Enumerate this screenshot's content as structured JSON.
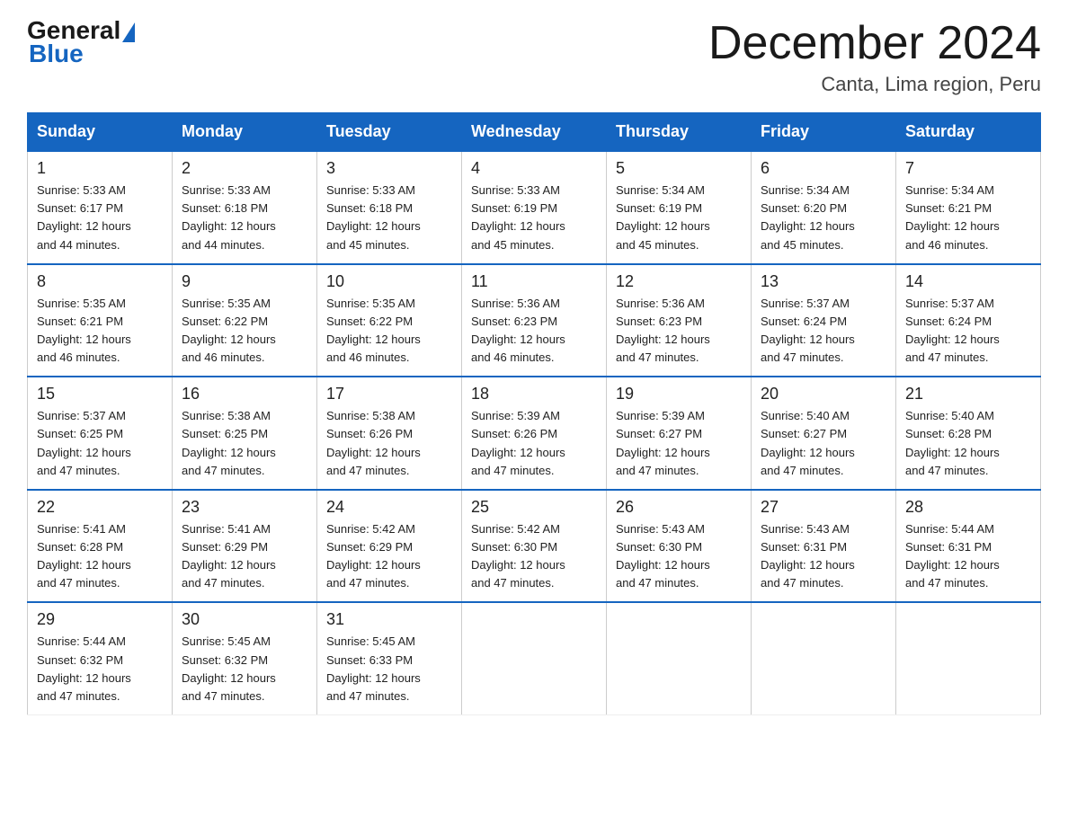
{
  "logo": {
    "general": "General",
    "blue": "Blue"
  },
  "title": "December 2024",
  "subtitle": "Canta, Lima region, Peru",
  "days_of_week": [
    "Sunday",
    "Monday",
    "Tuesday",
    "Wednesday",
    "Thursday",
    "Friday",
    "Saturday"
  ],
  "weeks": [
    [
      {
        "day": "1",
        "sunrise": "5:33 AM",
        "sunset": "6:17 PM",
        "daylight": "12 hours and 44 minutes."
      },
      {
        "day": "2",
        "sunrise": "5:33 AM",
        "sunset": "6:18 PM",
        "daylight": "12 hours and 44 minutes."
      },
      {
        "day": "3",
        "sunrise": "5:33 AM",
        "sunset": "6:18 PM",
        "daylight": "12 hours and 45 minutes."
      },
      {
        "day": "4",
        "sunrise": "5:33 AM",
        "sunset": "6:19 PM",
        "daylight": "12 hours and 45 minutes."
      },
      {
        "day": "5",
        "sunrise": "5:34 AM",
        "sunset": "6:19 PM",
        "daylight": "12 hours and 45 minutes."
      },
      {
        "day": "6",
        "sunrise": "5:34 AM",
        "sunset": "6:20 PM",
        "daylight": "12 hours and 45 minutes."
      },
      {
        "day": "7",
        "sunrise": "5:34 AM",
        "sunset": "6:21 PM",
        "daylight": "12 hours and 46 minutes."
      }
    ],
    [
      {
        "day": "8",
        "sunrise": "5:35 AM",
        "sunset": "6:21 PM",
        "daylight": "12 hours and 46 minutes."
      },
      {
        "day": "9",
        "sunrise": "5:35 AM",
        "sunset": "6:22 PM",
        "daylight": "12 hours and 46 minutes."
      },
      {
        "day": "10",
        "sunrise": "5:35 AM",
        "sunset": "6:22 PM",
        "daylight": "12 hours and 46 minutes."
      },
      {
        "day": "11",
        "sunrise": "5:36 AM",
        "sunset": "6:23 PM",
        "daylight": "12 hours and 46 minutes."
      },
      {
        "day": "12",
        "sunrise": "5:36 AM",
        "sunset": "6:23 PM",
        "daylight": "12 hours and 47 minutes."
      },
      {
        "day": "13",
        "sunrise": "5:37 AM",
        "sunset": "6:24 PM",
        "daylight": "12 hours and 47 minutes."
      },
      {
        "day": "14",
        "sunrise": "5:37 AM",
        "sunset": "6:24 PM",
        "daylight": "12 hours and 47 minutes."
      }
    ],
    [
      {
        "day": "15",
        "sunrise": "5:37 AM",
        "sunset": "6:25 PM",
        "daylight": "12 hours and 47 minutes."
      },
      {
        "day": "16",
        "sunrise": "5:38 AM",
        "sunset": "6:25 PM",
        "daylight": "12 hours and 47 minutes."
      },
      {
        "day": "17",
        "sunrise": "5:38 AM",
        "sunset": "6:26 PM",
        "daylight": "12 hours and 47 minutes."
      },
      {
        "day": "18",
        "sunrise": "5:39 AM",
        "sunset": "6:26 PM",
        "daylight": "12 hours and 47 minutes."
      },
      {
        "day": "19",
        "sunrise": "5:39 AM",
        "sunset": "6:27 PM",
        "daylight": "12 hours and 47 minutes."
      },
      {
        "day": "20",
        "sunrise": "5:40 AM",
        "sunset": "6:27 PM",
        "daylight": "12 hours and 47 minutes."
      },
      {
        "day": "21",
        "sunrise": "5:40 AM",
        "sunset": "6:28 PM",
        "daylight": "12 hours and 47 minutes."
      }
    ],
    [
      {
        "day": "22",
        "sunrise": "5:41 AM",
        "sunset": "6:28 PM",
        "daylight": "12 hours and 47 minutes."
      },
      {
        "day": "23",
        "sunrise": "5:41 AM",
        "sunset": "6:29 PM",
        "daylight": "12 hours and 47 minutes."
      },
      {
        "day": "24",
        "sunrise": "5:42 AM",
        "sunset": "6:29 PM",
        "daylight": "12 hours and 47 minutes."
      },
      {
        "day": "25",
        "sunrise": "5:42 AM",
        "sunset": "6:30 PM",
        "daylight": "12 hours and 47 minutes."
      },
      {
        "day": "26",
        "sunrise": "5:43 AM",
        "sunset": "6:30 PM",
        "daylight": "12 hours and 47 minutes."
      },
      {
        "day": "27",
        "sunrise": "5:43 AM",
        "sunset": "6:31 PM",
        "daylight": "12 hours and 47 minutes."
      },
      {
        "day": "28",
        "sunrise": "5:44 AM",
        "sunset": "6:31 PM",
        "daylight": "12 hours and 47 minutes."
      }
    ],
    [
      {
        "day": "29",
        "sunrise": "5:44 AM",
        "sunset": "6:32 PM",
        "daylight": "12 hours and 47 minutes."
      },
      {
        "day": "30",
        "sunrise": "5:45 AM",
        "sunset": "6:32 PM",
        "daylight": "12 hours and 47 minutes."
      },
      {
        "day": "31",
        "sunrise": "5:45 AM",
        "sunset": "6:33 PM",
        "daylight": "12 hours and 47 minutes."
      },
      null,
      null,
      null,
      null
    ]
  ]
}
